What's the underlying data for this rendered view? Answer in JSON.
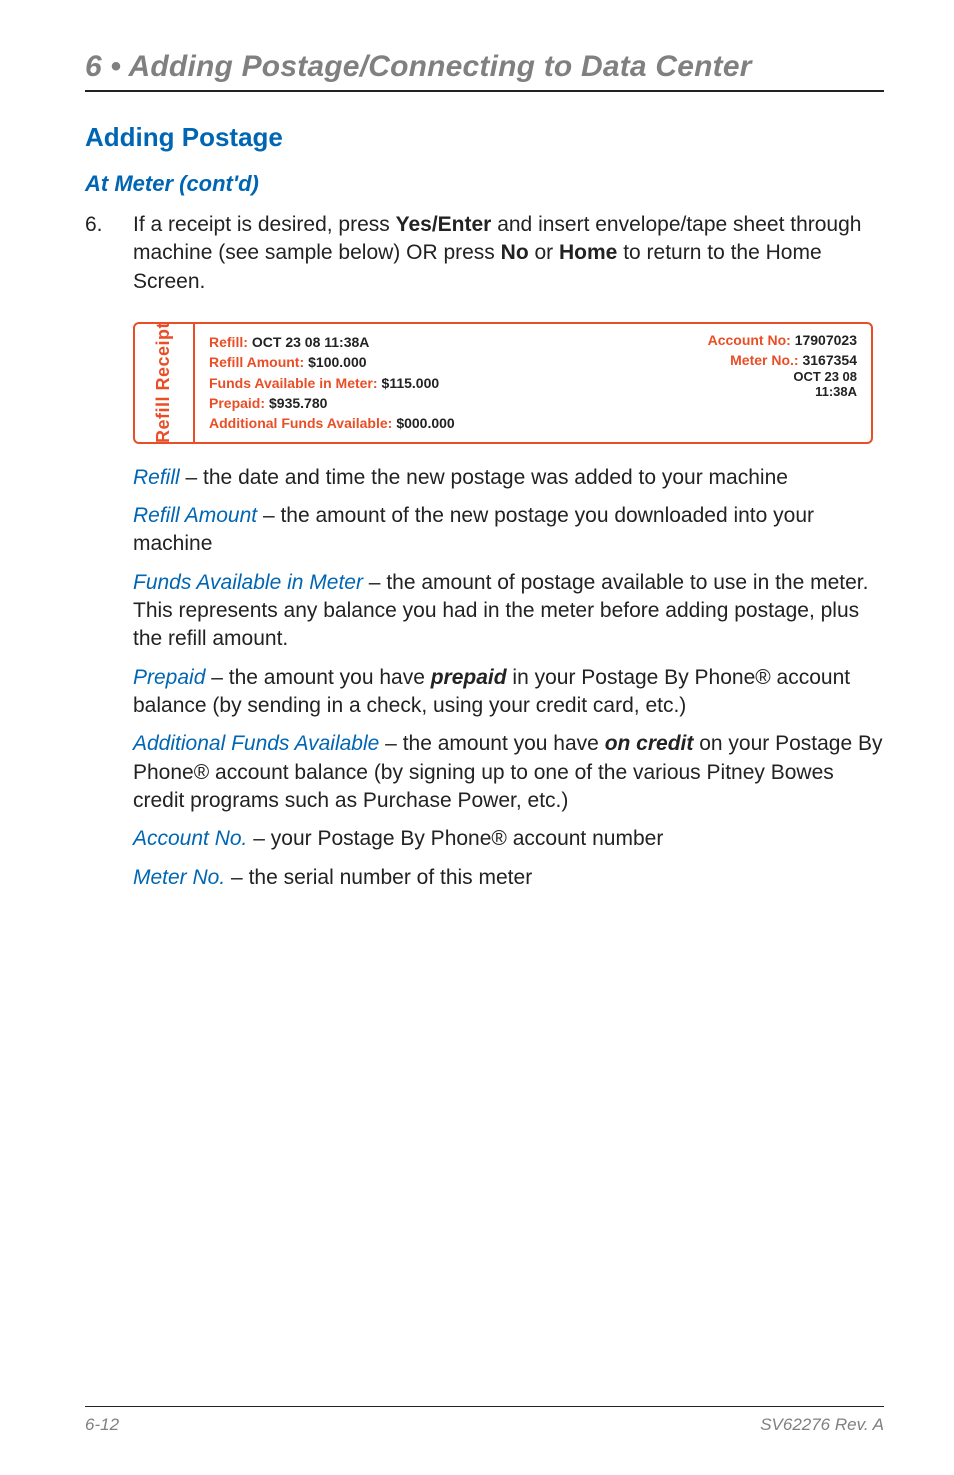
{
  "chapter": "6 • Adding Postage/Connecting to Data Center",
  "section": "Adding Postage",
  "subsection": "At Meter (cont'd)",
  "step_num": "6.",
  "step_text_1": "If a receipt is desired, press ",
  "step_bold_1": "Yes/Enter",
  "step_text_2": " and insert envelope/tape sheet through machine (see sample below) OR press ",
  "step_bold_2": "No",
  "step_text_3": " or ",
  "step_bold_3": "Home",
  "step_text_4": " to return to the Home Screen.",
  "receipt": {
    "side": "Refill Receipt",
    "lines": {
      "refill_lbl": "Refill:",
      "refill_val": " OCT 23 08   11:38A",
      "amount_lbl": "Refill Amount:",
      "amount_val": " $100.000",
      "funds_lbl": "Funds Available in Meter:",
      "funds_val": " $115.000",
      "prepaid_lbl": "Prepaid:",
      "prepaid_val": " $935.780",
      "addl_lbl": "Additional Funds Available:",
      "addl_val": " $000.000"
    },
    "account_lbl": "Account No:",
    "account_val": " 17907023",
    "meter_lbl": "Meter No.:",
    "meter_val": "   3167354",
    "meter_sub1": "OCT 23 08",
    "meter_sub2": "11:38A"
  },
  "defs": [
    {
      "term": "Refill",
      "dash": " – ",
      "text": "the date and time the new postage was added to your machine"
    },
    {
      "term": "Refill Amount",
      "dash": " – ",
      "text": "the amount of the new postage you downloaded into your machine"
    },
    {
      "term": "Funds Available in Meter",
      "dash": " – ",
      "text": "the amount of postage available to use in the meter. This represents any balance you had in the meter before adding postage, plus the refill amount."
    },
    {
      "term": "Prepaid",
      "dash": " –  ",
      "pre": "the amount you have ",
      "bold": "prepaid",
      "post": " in your Postage By Phone® account balance (by sending in a check, using your credit card, etc.)"
    },
    {
      "term": "Additional Funds Available",
      "dash": " – ",
      "pre": "the amount you have ",
      "bold": "on credit",
      "post": " on your Postage By Phone® account balance (by signing up to one of the various Pitney Bowes credit programs such as Purchase Power, etc.)"
    },
    {
      "term": "Account No.",
      "dash": " – ",
      "text": "your Postage By Phone® account number"
    },
    {
      "term": "Meter No.",
      "dash": " – ",
      "text": "the serial number of this meter"
    }
  ],
  "footer_left": "6-12",
  "footer_right": "SV62276 Rev. A"
}
